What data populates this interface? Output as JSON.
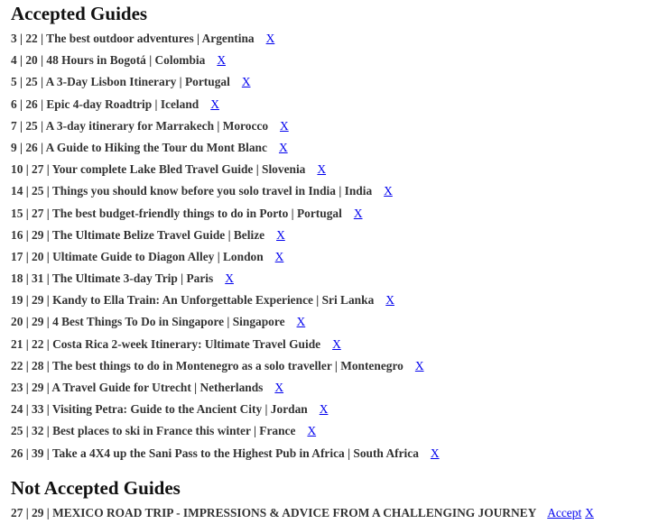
{
  "accepted": {
    "title": "Accepted Guides",
    "remove_label": "X",
    "items": [
      "3 | 22 | The best outdoor adventures | Argentina",
      "4 | 20 | 48 Hours in Bogotá | Colombia",
      "5 | 25 | A 3-Day Lisbon Itinerary | Portugal",
      "6 | 26 | Epic 4-day Roadtrip | Iceland",
      "7 | 25 | A 3-day itinerary for Marrakech | Morocco",
      "9 | 26 | A Guide to Hiking the Tour du Mont Blanc",
      "10 | 27 | Your complete Lake Bled Travel Guide | Slovenia",
      "14 | 25 | Things you should know before you solo travel in India | India",
      "15 | 27 | The best budget-friendly things to do in Porto | Portugal",
      "16 | 29 | The Ultimate Belize Travel Guide | Belize",
      "17 | 20 | Ultimate Guide to Diagon Alley | London",
      "18 | 31 | The Ultimate 3-day Trip | Paris",
      "19 | 29 | Kandy to Ella Train: An Unforgettable Experience | Sri Lanka",
      "20 | 29 | 4 Best Things To Do in Singapore | Singapore",
      "21 | 22 | Costa Rica 2-week Itinerary: Ultimate Travel Guide",
      "22 | 28 | The best things to do in Montenegro as a solo traveller | Montenegro",
      "23 | 29 | A Travel Guide for Utrecht | Netherlands",
      "24 | 33 | Visiting Petra: Guide to the Ancient City | Jordan",
      "25 | 32 | Best places to ski in France this winter | France",
      "26 | 39 | Take a 4X4 up the Sani Pass to the Highest Pub in Africa | South Africa"
    ]
  },
  "not_accepted": {
    "title": "Not Accepted Guides",
    "accept_label": "Accept",
    "remove_label": "X",
    "items": [
      "27 | 29 | MEXICO ROAD TRIP - IMPRESSIONS & ADVICE FROM A CHALLENGING JOURNEY"
    ]
  }
}
